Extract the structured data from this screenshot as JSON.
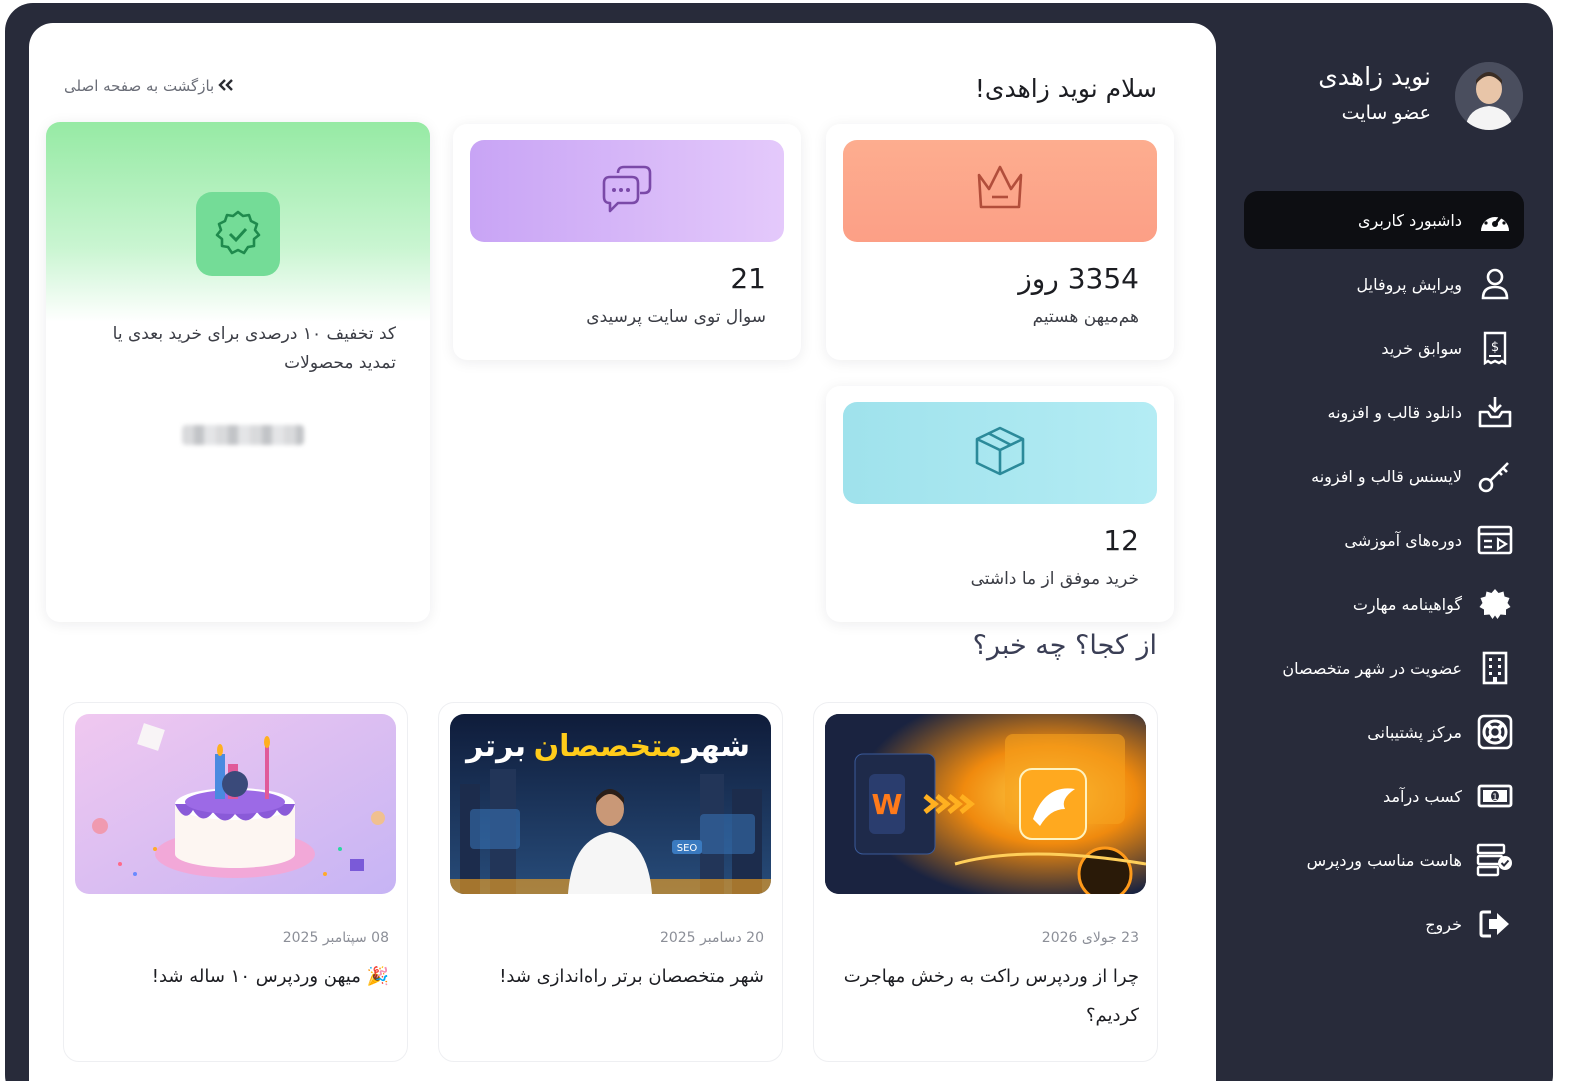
{
  "sidebar": {
    "user_name": "نوید زاهدی",
    "user_role": "عضو سایت",
    "items": [
      {
        "label": "داشبورد کاربری",
        "icon": "dashboard-gauge-icon"
      },
      {
        "label": "ویرایش پروفایل",
        "icon": "user-icon"
      },
      {
        "label": "سوابق خرید",
        "icon": "receipt-icon"
      },
      {
        "label": "دانلود قالب و افزونه",
        "icon": "download-tray-icon"
      },
      {
        "label": "لایسنس قالب و افزونه",
        "icon": "key-icon"
      },
      {
        "label": "دوره‌های آموزشی",
        "icon": "video-course-icon"
      },
      {
        "label": "گواهینامه مهارت",
        "icon": "certificate-badge-icon"
      },
      {
        "label": "عضویت در شهر متخصصان",
        "icon": "building-icon"
      },
      {
        "label": "مرکز پشتیبانی",
        "icon": "lifebuoy-icon"
      },
      {
        "label": "کسب درآمد",
        "icon": "money-icon"
      },
      {
        "label": "هاست مناسب وردپرس",
        "icon": "server-check-icon"
      },
      {
        "label": "خروج",
        "icon": "logout-icon"
      }
    ]
  },
  "main": {
    "greeting": "سلام نوید زاهدی!",
    "back_link": "بازگشت به صفحه اصلی",
    "stats": [
      {
        "value": "3354 روز",
        "label": "هم‌میهن هستیم",
        "icon": "crown-icon",
        "color": "#fda48a"
      },
      {
        "value": "21",
        "label": "سوال توی سایت پرسیدی",
        "icon": "chat-bubbles-icon",
        "color": "#d3acf7"
      },
      {
        "value": "12",
        "label": "خرید موفق از ما داشتی",
        "icon": "package-icon",
        "color": "#a8e6f0"
      }
    ],
    "coupon": {
      "text": "کد تخفیف ۱۰ درصدی برای خرید بعدی یا تمدید محصولات",
      "icon": "verified-badge-icon"
    },
    "news_title": "از کجا؟ چه خبر؟",
    "news": [
      {
        "date": "23 جولای 2026",
        "title": "چرا از وردپرس راکت به رخش مهاجرت کردیم؟"
      },
      {
        "date": "20 دسامبر 2025",
        "title": "شهر متخصصان برتر راه‌اندازی شد!",
        "image_text": {
          "part1": "شهر",
          "part2": "متخصصان",
          "part3": "برتر",
          "seo": "SEO"
        }
      },
      {
        "date": "08 سپتامبر 2025",
        "title": "میهن وردپرس ۱۰ ساله شد!",
        "emoji": "🎉"
      }
    ]
  },
  "colors": {
    "sidebar_bg": "#282b3a",
    "active_item_bg": "#0d0e12",
    "coupon_green": "#74dc97"
  }
}
